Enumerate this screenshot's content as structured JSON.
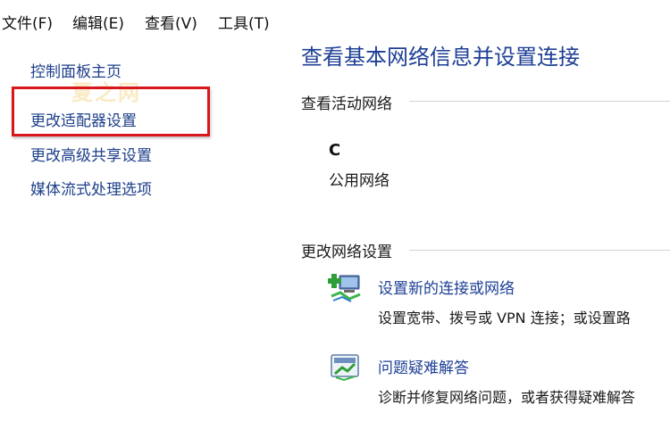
{
  "menubar": {
    "items": [
      "文件(F)",
      "编辑(E)",
      "查看(V)",
      "工具(T)"
    ]
  },
  "sidebar": {
    "items": [
      "控制面板主页",
      "更改适配器设置",
      "更改高级共享设置",
      "媒体流式处理选项"
    ]
  },
  "watermark": "夏之网",
  "main": {
    "title": "查看基本网络信息并设置连接",
    "active_networks": {
      "heading": "查看活动网络",
      "network_name": "C",
      "network_type": "公用网络"
    },
    "change_settings": {
      "heading": "更改网络设置",
      "tasks": [
        {
          "label": "设置新的连接或网络",
          "description": "设置宽带、拨号或 VPN 连接；或设置路",
          "icon": "new-connection-icon"
        },
        {
          "label": "问题疑难解答",
          "description": "诊断并修复网络问题，或者获得疑难解答",
          "icon": "troubleshoot-icon"
        }
      ]
    }
  },
  "colors": {
    "link": "#1d3f8a",
    "title": "#1e3f95",
    "highlight": "#d9161c"
  }
}
